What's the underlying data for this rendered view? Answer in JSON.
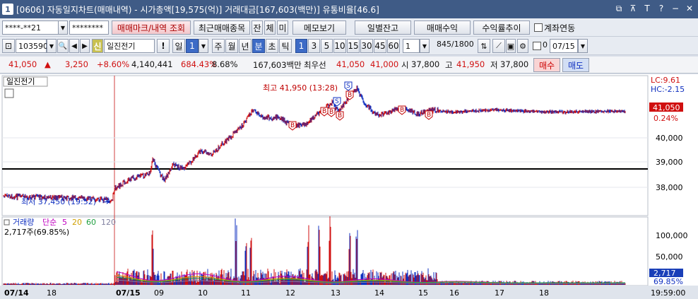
{
  "window": {
    "number": "1",
    "title": "[0606] 자동일지차트(매매내역) - 시가총액[19,575(억)] 거래대금[167,603(백만)] 유통비율[46.6]",
    "icons": [
      "restore-icon",
      "pin-icon",
      "font-size-icon",
      "help-icon",
      "minimize-icon",
      "close-icon"
    ]
  },
  "toolbar1": {
    "account": "****-**21",
    "password": "********",
    "btn_trade_mark": "매매마크/내역 조회",
    "btn_recent": "최근매매종목",
    "btn_jan": "잔",
    "btn_che": "체",
    "btn_mi": "미",
    "btn_memo": "메모보기",
    "btn_daily_balance": "일별잔고",
    "btn_trade_profit": "매매수익",
    "btn_yield": "수익률추이",
    "chk_link": "계좌연동"
  },
  "toolbar2": {
    "code": "103590",
    "shin": "신",
    "stock_name": "일진전기",
    "excl": "!",
    "period_il": "일",
    "period_num": "1",
    "periods": [
      "주",
      "월",
      "년",
      "분",
      "초",
      "틱"
    ],
    "selected_period": "분",
    "intervals": [
      "1",
      "3",
      "5",
      "10",
      "15",
      "30",
      "45",
      "60"
    ],
    "selected_interval": "1",
    "custom_interval": "1",
    "count": "845",
    "count_total": "/1800",
    "checkbox_value": "0",
    "date": "07/15"
  },
  "quote": {
    "price": "41,050",
    "arrow": "▲",
    "change": "3,250",
    "pct": "+8.60%",
    "volume": "4,140,441",
    "vol_ratio": "684.43%",
    "turnover": "8.68%",
    "amount": "167,603백만",
    "best_label": "최우선",
    "ask": "41,050",
    "bid": "41,000",
    "open_label": "시",
    "open": "37,800",
    "high_label": "고",
    "high": "41,950",
    "low_label": "저",
    "low": "37,800",
    "buy": "매수",
    "sell": "매도"
  },
  "chart": {
    "stock_label": "일진전기",
    "high_annotation": "최고 41,950 (13:28)",
    "low_annotation": "최저 37,450 (19:52)",
    "lc": "LC:9.61",
    "hc": "HC:-2.15",
    "last_price": "41,050",
    "last_pct": "0.24%",
    "price_ticks": [
      "40,000",
      "39,000",
      "38,000"
    ],
    "volume_legend": {
      "name": "거래량",
      "ma_label": "단순",
      "ma": [
        "5",
        "20",
        "60",
        "120"
      ],
      "ma_colors": [
        "#c000c0",
        "#d0a000",
        "#20a040",
        "#8080a0"
      ],
      "value": "2,717주(69.85%)"
    },
    "volume_ticks": [
      "100,000",
      "50,000"
    ],
    "last_volume": "2,717",
    "last_volume_pct": "69.85%",
    "x_labels": [
      "07/14",
      "18",
      "07/15",
      "09",
      "10",
      "11",
      "12",
      "13",
      "14",
      "15",
      "16",
      "17",
      "18"
    ],
    "time_label": "19:59:00",
    "marks_buy": "B",
    "marks_sell": "S"
  },
  "colors": {
    "up": "#d01010",
    "down": "#1030c0",
    "title_bar": "#3f5b86",
    "selected": "#3d6bc6"
  }
}
